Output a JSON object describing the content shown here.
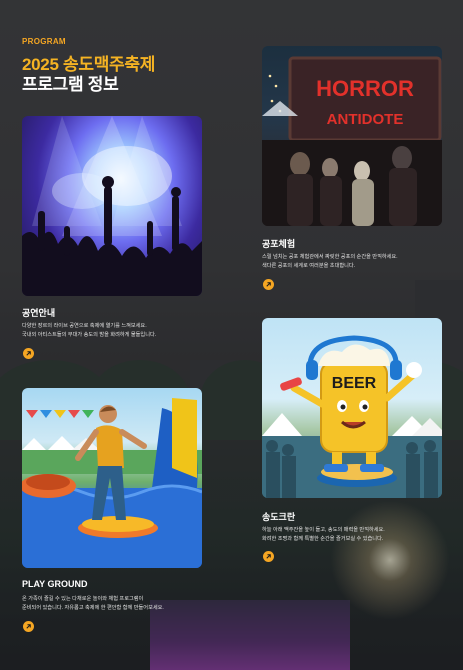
{
  "header": {
    "eyebrow": "PROGRAM",
    "title_line1": "2025 송도맥주축제",
    "title_line2": "프로그램 정보"
  },
  "cards": [
    {
      "id": "concert",
      "title": "공연안내",
      "desc_line1": "다양한 장르의 라이브 공연으로 축제에 열기를 느껴보세요.",
      "desc_line2": "국내외 아티스트들의 무대가 송도의 밤을 화려하게 물들입니다.",
      "image_icon": "concert-crowd-image"
    },
    {
      "id": "horror",
      "title": "공포체험",
      "desc_line1": "스릴 넘치는 공포 체험관에서 짜릿한 공포의 순간을 만끽하세요.",
      "desc_line2": "색다른 공포의 세계로 여러분을 초대합니다.",
      "image_sign": "HORROR",
      "image_sign2": "ANTIDOTE"
    },
    {
      "id": "beer",
      "title": "송도크란",
      "desc_line1": "하늘 아래 맥주잔을 높이 들고, 송도의 매력을 만끽하세요.",
      "desc_line2": "화려한 조명과 함께 특별한 순간을 즐거보실 수 있습니다.",
      "image_label": "BEER"
    },
    {
      "id": "playground",
      "title": "PLAY GROUND",
      "desc_line1": "온 가족이 즐길 수 있는 다채로운 놀이와 체험 프로그램이",
      "desc_line2": "준비되어 있습니다. 자유롭고 축제에 한 편안함 함께 만들어보세요."
    }
  ],
  "colors": {
    "accent": "#f5a623",
    "title_accent": "#f5b323",
    "background": "#2c2d2f"
  }
}
